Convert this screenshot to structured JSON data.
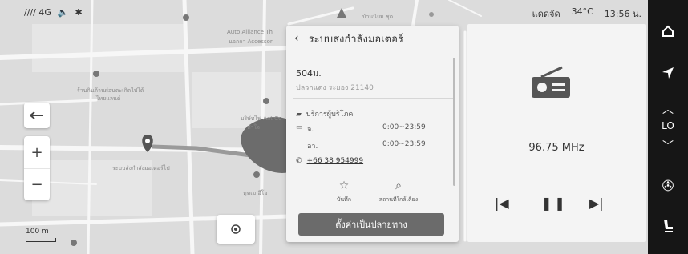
{
  "status_bar": {
    "signal": "//// 4G",
    "volume_icon": "volume-icon",
    "bluetooth_icon": "bluetooth-icon",
    "traffic": "แดดจัด",
    "temperature": "34°C",
    "time": "13:56 น."
  },
  "map": {
    "labels": {
      "auto_alliance": "Auto Alliance Th",
      "auto_alliance_sub": "นอกกา Accessor",
      "poi_left": "ร้านกินด้านผ่อนดะเกิดไปได้",
      "poi_left_sub": "ไทยแลนด์",
      "poi_mid": "บริษัทไฟ Aat Co",
      "poi_mid_sub": "ทำใจ",
      "road_label": "ระบบส่งกำลังมอเตอร์ไป",
      "poi_bottom": "ทูทเม อีโอ",
      "top_road": "บ้านนิยม ชุด"
    },
    "scale_label": "100 m"
  },
  "info_panel": {
    "back_icon": "chevron-left-icon",
    "title": "ระบบส่งกำลังมอเตอร์",
    "distance": "504ม.",
    "address": "ปลวกแดง ระยอง 21140",
    "category": "บริการผู้บริโภค",
    "hours": [
      {
        "day": "จ.",
        "time": "0:00~23:59"
      },
      {
        "day": "อา.",
        "time": "0:00~23:59"
      }
    ],
    "phone": "+66 38 954999",
    "actions": [
      {
        "icon": "star-icon",
        "label": "บันทึก"
      },
      {
        "icon": "search-icon",
        "label": "สถานที่ใกล้เคียง"
      }
    ],
    "set_destination": "ตั้งค่าเป็นปลายทาง"
  },
  "radio": {
    "frequency": "96.75 MHz",
    "prev_icon": "previous-track-icon",
    "pause_icon": "pause-icon",
    "next_icon": "next-track-icon"
  },
  "rail": {
    "home_icon": "home-icon",
    "navigation_icon": "navigation-arrow-icon",
    "temp_up_icon": "chevron-up-icon",
    "temp_label": "LO",
    "temp_down_icon": "chevron-down-icon",
    "fan_icon": "fan-icon",
    "seat_icon": "seat-icon"
  }
}
